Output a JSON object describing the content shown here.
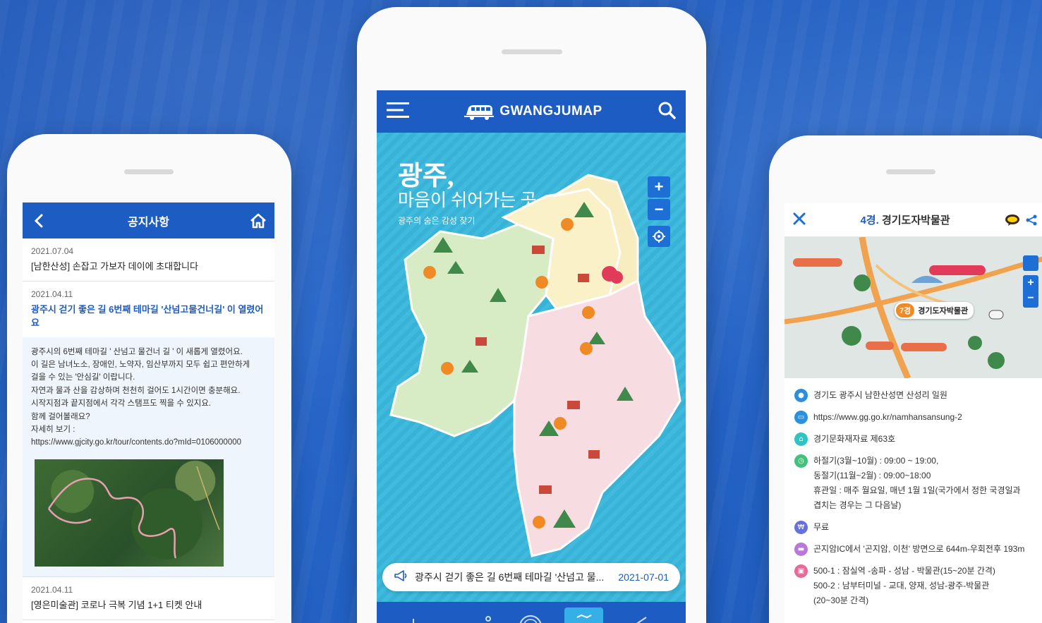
{
  "left_phone": {
    "header": {
      "title": "공지사항"
    },
    "notices": [
      {
        "date": "2021.07.04",
        "title": "[남한산성] 손잡고 가보자 데이에 초대합니다"
      },
      {
        "date": "2021.04.11",
        "title": "광주시 걷기 좋은 길 6번째 테마길 '산넘고물건너길' 이 열렸어요"
      },
      {
        "date": "2021.04.11",
        "title": "[영은미술관] 코로나 극복 기념 1+1 티켓 안내"
      }
    ],
    "body_lines": [
      "광주시의 6번째 테마길 ' 산넘고 물건너 길 ' 이 새롭게 열렸어요.",
      "이 길은 남녀노소, 장애인, 노약자, 임산부까지 모두 쉽고 편안하게",
      "걸을 수 있는 '안심길' 이랍니다.",
      "자연과 물과 산을 감상하며 천천히 걸어도 1시간이면 충분해요.",
      "시작지점과 끝지점에서 각각 스탬프도 찍을 수 있지요.",
      "함께 걸어볼래요?",
      "자세히 보기 :",
      "https://www.gjcity.go.kr/tour/contents.do?mId=0106000000"
    ]
  },
  "center_phone": {
    "logo_text": "GWANGJUMAP",
    "tagline_title": "광주,",
    "tagline_sub": "마음이 쉬어가는 곳",
    "tagline_small": "광주의 숨은 감성 찾기",
    "zoom_in": "+",
    "zoom_out": "−",
    "notice_bar": {
      "text": "광주시 걷기 좋은 길 6번째 테마길 '산넘고 물...",
      "date": "2021-07-01"
    }
  },
  "right_phone": {
    "header": {
      "number": "4경.",
      "title": "경기도자박물관"
    },
    "map_marker": {
      "number": "7경",
      "label": "경기도자박물관"
    },
    "info": [
      {
        "icon": "location-icon",
        "color": "#2b8fe0",
        "lines": [
          "경기도 광주시 남한산성면 산성리 일원"
        ]
      },
      {
        "icon": "homepage-icon",
        "color": "#2b8fe0",
        "lines": [
          "https://www.gg.go.kr/namhansansung-2"
        ]
      },
      {
        "icon": "heritage-icon",
        "color": "#2ec4c0",
        "lines": [
          "경기문화재자료 제63호"
        ]
      },
      {
        "icon": "hours-icon",
        "color": "#45c07a",
        "lines": [
          "하절기(3월~10월) : 09:00 ~ 19:00,",
          "동절기(11월~2월) : 09:00~18:00",
          "휴관일 : 매주 월요일, 매년 1월 1일(국가에서 정한 국경일과",
          "겹치는 경우는 그 다음날)"
        ]
      },
      {
        "icon": "fee-icon",
        "color": "#6a6fe0",
        "lines": [
          "무료"
        ]
      },
      {
        "icon": "car-icon",
        "color": "#b77ad8",
        "lines": [
          "곤지암IC에서 '곤지암, 이천' 방면으로 644m-우회전후 193m"
        ]
      },
      {
        "icon": "bus-icon",
        "color": "#e46a9b",
        "lines": [
          "500-1 : 잠실역 -송파 - 성남 - 박물관(15~20분 간격)",
          "500-2 : 남부터미널 - 교대, 양재, 성남-광주-박물관",
          "(20~30분 간격)"
        ]
      }
    ]
  },
  "colors": {
    "brand_blue": "#1d5cc2",
    "map_sea": "#3ab5d8",
    "accent_orange": "#f08a24"
  }
}
